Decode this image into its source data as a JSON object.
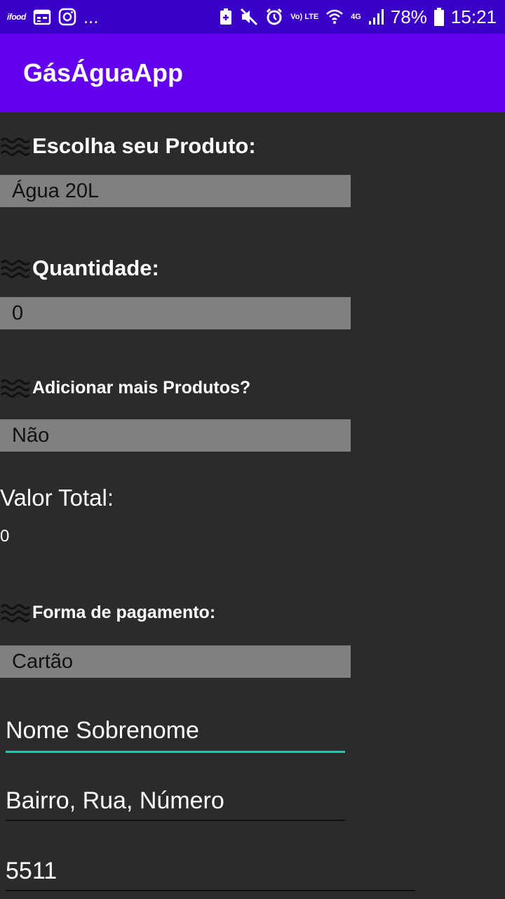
{
  "status_bar": {
    "left_apps": [
      "ifood",
      "calendar-icon",
      "instagram-icon"
    ],
    "overflow": "...",
    "volte": "Vo) LTE",
    "network": "4G",
    "battery": "78%",
    "time": "15:21"
  },
  "app": {
    "title": "GásÁguaApp"
  },
  "product": {
    "label": "Escolha seu Produto:",
    "value": "Água 20L"
  },
  "quantity": {
    "label": "Quantidade:",
    "value": "0"
  },
  "more_products": {
    "label": "Adicionar mais Produtos?",
    "value": "Não"
  },
  "total": {
    "label": "Valor Total:",
    "value": "0"
  },
  "payment": {
    "label": "Forma de pagamento:",
    "value": "Cartão"
  },
  "fields": {
    "name": "Nome Sobrenome",
    "address": "Bairro, Rua, Número",
    "phone": "5511"
  },
  "colors": {
    "status_bar": "#3a00c8",
    "app_bar": "#6200ee",
    "background": "#2b2b2b",
    "spinner": "#808080",
    "accent": "#1fc7b6"
  }
}
